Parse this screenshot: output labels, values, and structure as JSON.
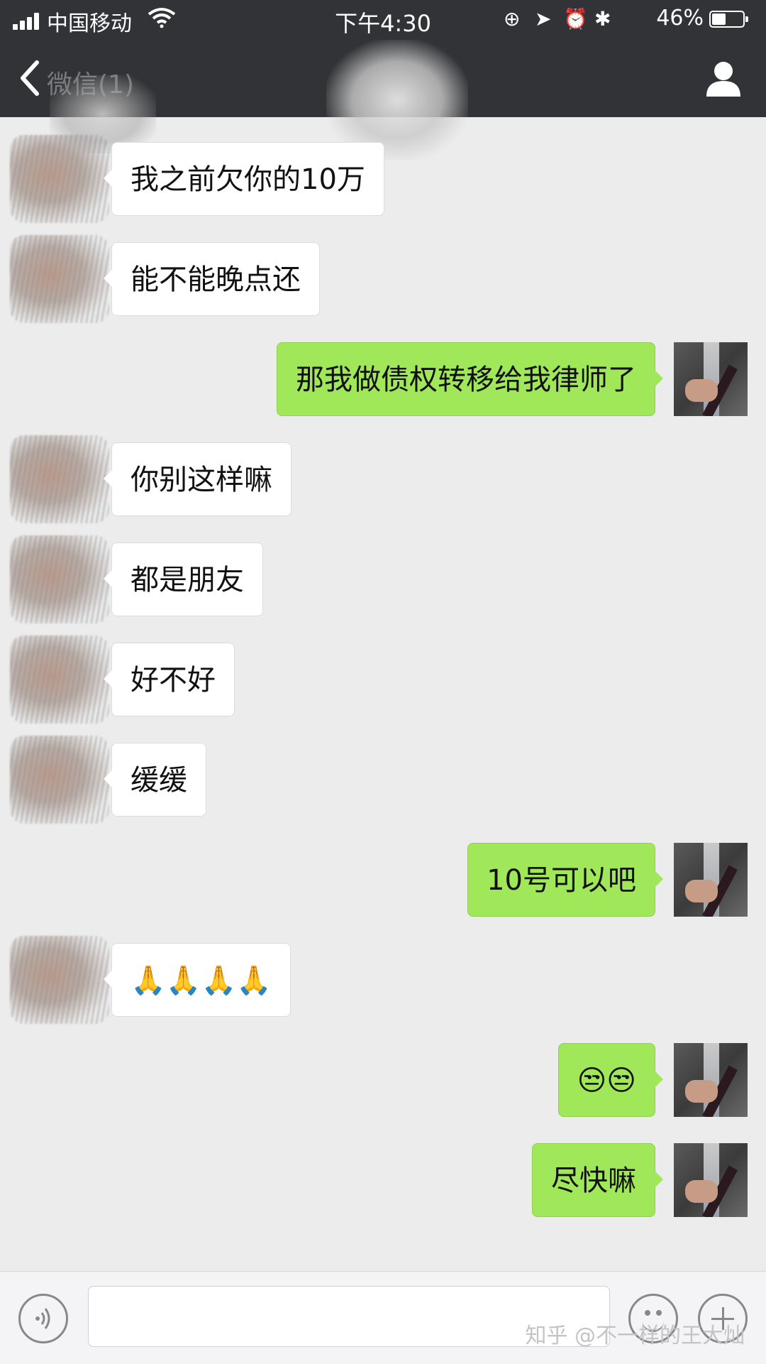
{
  "status_bar": {
    "carrier": "中国移动",
    "time": "下午4:30",
    "battery_percent": "46%",
    "battery_level": 0.46
  },
  "nav": {
    "back_label": "微信(1)",
    "chat_title": "",
    "profile_icon": "person-icon"
  },
  "messages": [
    {
      "side": "in",
      "text": "我之前欠你的10万"
    },
    {
      "side": "in",
      "text": "能不能晚点还"
    },
    {
      "side": "out",
      "text": "那我做债权转移给我律师了"
    },
    {
      "side": "in",
      "text": "你别这样嘛"
    },
    {
      "side": "in",
      "text": "都是朋友"
    },
    {
      "side": "in",
      "text": "好不好"
    },
    {
      "side": "in",
      "text": "缓缓"
    },
    {
      "side": "out",
      "text": "10号可以吧"
    },
    {
      "side": "in",
      "text": "🙏🙏🙏🙏"
    },
    {
      "side": "out",
      "text": "😒😒"
    },
    {
      "side": "out",
      "text": "尽快嘛"
    }
  ],
  "input_bar": {
    "voice_icon": "voice-icon",
    "emoji_icon": "emoji-icon",
    "plus_icon": "plus-icon",
    "text_value": ""
  },
  "watermark": "知乎 @不一样的王大灿"
}
